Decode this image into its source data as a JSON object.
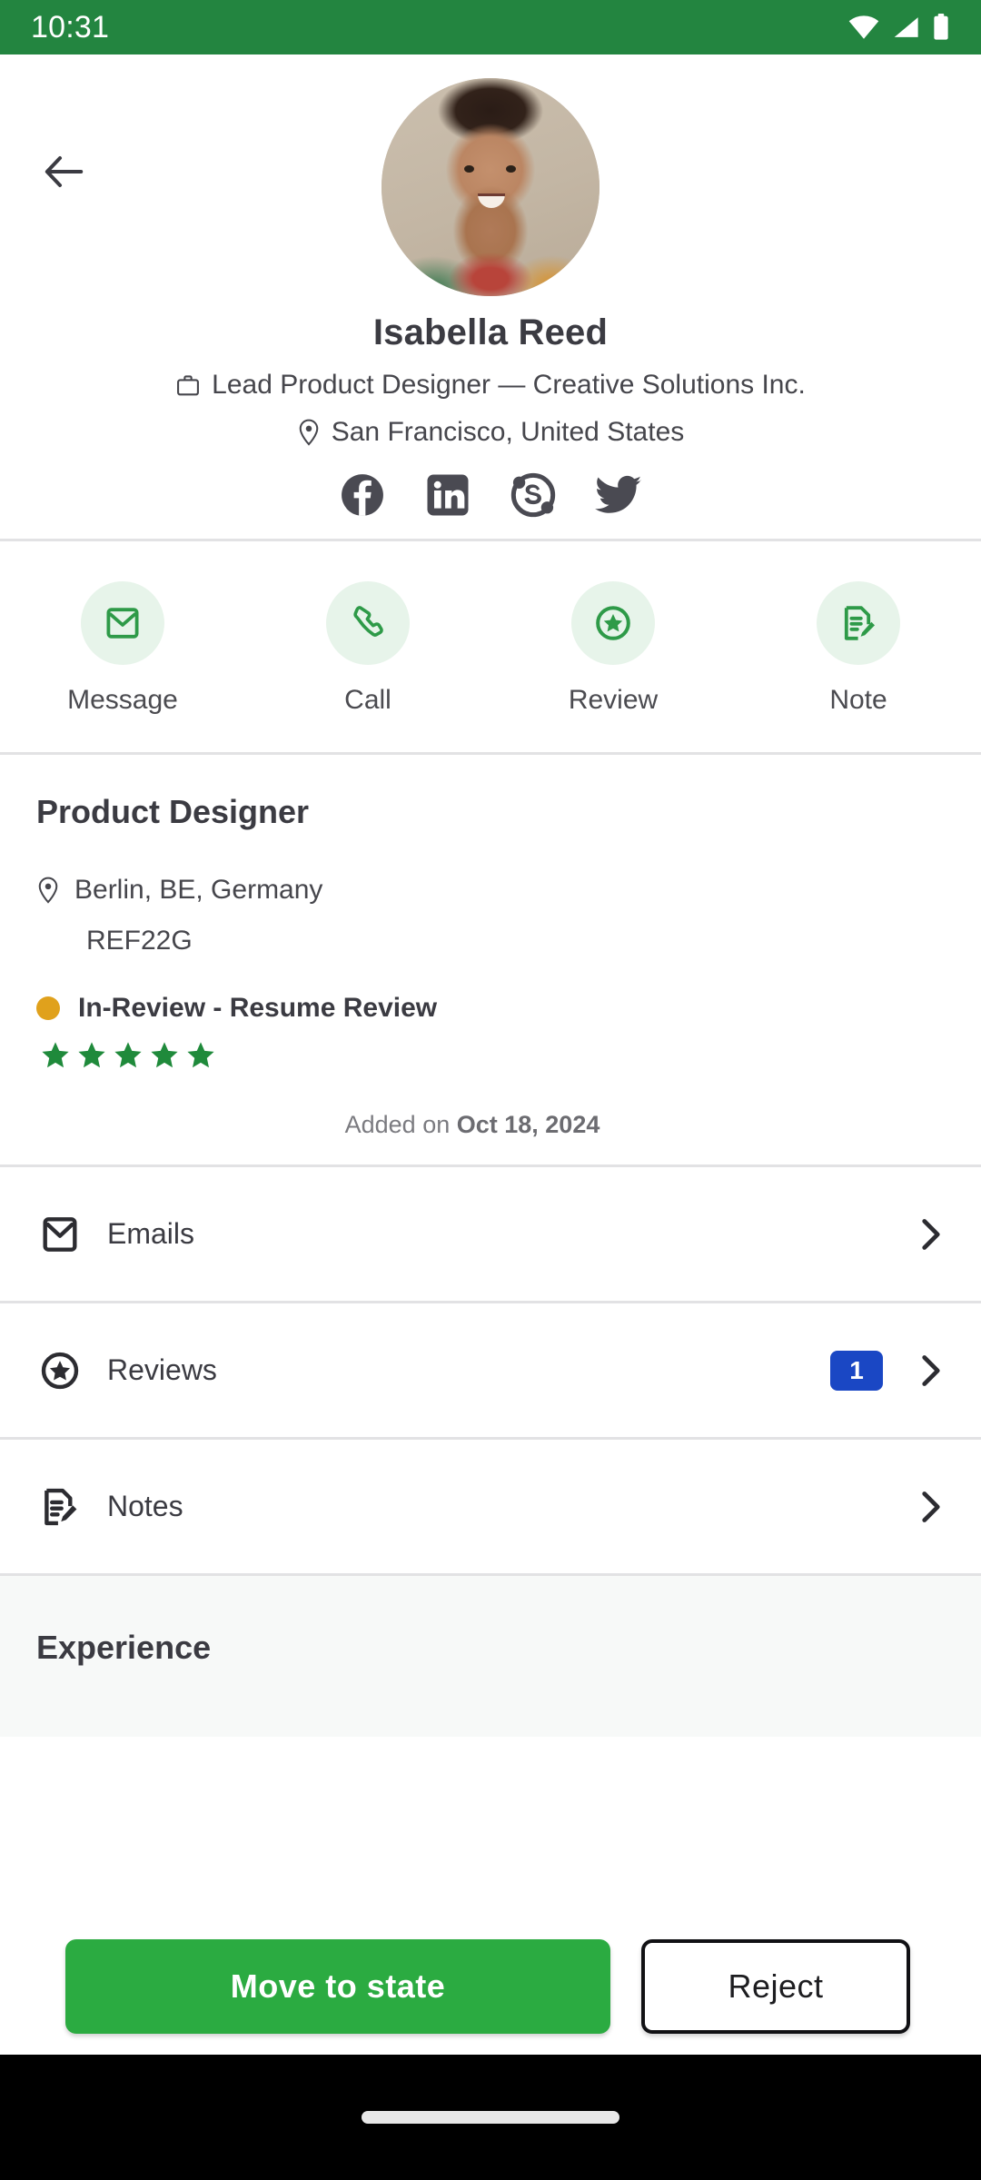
{
  "status_bar": {
    "time": "10:31",
    "background_color": "#238540",
    "icons": [
      "wifi-icon",
      "cell-signal-icon",
      "battery-icon"
    ]
  },
  "header": {
    "back_icon": "back-arrow-icon",
    "avatar_alt": "Isabella Reed profile photo",
    "name": "Isabella Reed",
    "job_title_icon": "briefcase-icon",
    "job_title": "Lead Product Designer — Creative Solutions Inc.",
    "location_icon": "map-pin-icon",
    "location": "San Francisco, United States",
    "socials": [
      {
        "name": "facebook-icon",
        "label": "Facebook"
      },
      {
        "name": "linkedin-icon",
        "label": "LinkedIn"
      },
      {
        "name": "skype-icon",
        "label": "Skype"
      },
      {
        "name": "twitter-icon",
        "label": "Twitter"
      }
    ]
  },
  "quick_actions": [
    {
      "icon": "envelope-icon",
      "label": "Message"
    },
    {
      "icon": "phone-icon",
      "label": "Call"
    },
    {
      "icon": "star-circle-icon",
      "label": "Review"
    },
    {
      "icon": "note-edit-icon",
      "label": "Note"
    }
  ],
  "job": {
    "title": "Product Designer",
    "location_icon": "map-pin-icon",
    "location": "Berlin, BE, Germany",
    "reference": "REF22G",
    "status_dot_color": "#e0a11c",
    "status": "In-Review - Resume Review",
    "rating": 5,
    "rating_max": 5,
    "star_color": "#1f8a3b",
    "added_prefix": "Added on",
    "added_date": "Oct 18, 2024"
  },
  "nav_rows": [
    {
      "icon": "envelope-icon",
      "label": "Emails",
      "badge": null,
      "chevron": "chevron-right-icon"
    },
    {
      "icon": "star-circle-icon",
      "label": "Reviews",
      "badge": "1",
      "chevron": "chevron-right-icon"
    },
    {
      "icon": "note-edit-icon",
      "label": "Notes",
      "badge": null,
      "chevron": "chevron-right-icon"
    }
  ],
  "badge_color": "#1a47c4",
  "experience": {
    "title": "Experience"
  },
  "bottom_bar": {
    "primary_label": "Move to state",
    "primary_color": "#2bab41",
    "secondary_label": "Reject"
  },
  "gesture_bar": {
    "indicator": "home-indicator"
  }
}
